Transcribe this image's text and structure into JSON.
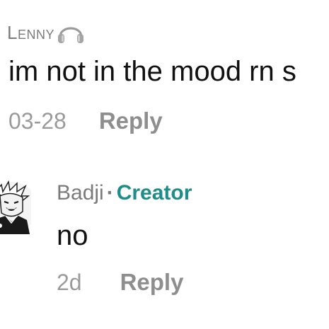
{
  "comment1": {
    "author": "Lenny",
    "badge_icon": "headphones-icon",
    "text": "im not in the mood rn s",
    "date": "03-28",
    "reply_label": "Reply"
  },
  "comment2": {
    "author": "Badji",
    "separator": "·",
    "role": "Creator",
    "text": "no",
    "date": "2d",
    "reply_label": "Reply",
    "role_color": "#1e8c8a"
  }
}
